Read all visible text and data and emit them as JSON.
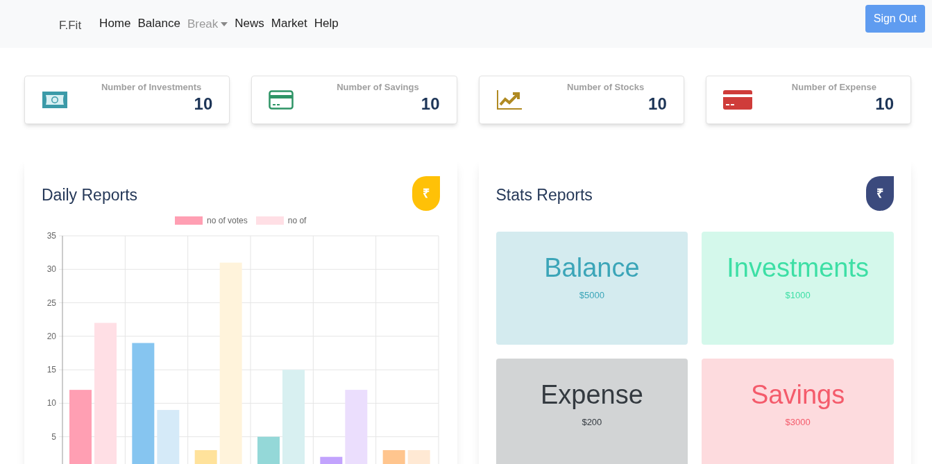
{
  "navbar": {
    "brand": "F.Fit",
    "links": [
      {
        "label": "Home",
        "disabled": false,
        "dropdown": false
      },
      {
        "label": "Balance",
        "disabled": false,
        "dropdown": false
      },
      {
        "label": "Break",
        "disabled": true,
        "dropdown": true
      },
      {
        "label": "News",
        "disabled": false,
        "dropdown": false
      },
      {
        "label": "Market",
        "disabled": false,
        "dropdown": false
      },
      {
        "label": "Help",
        "disabled": false,
        "dropdown": false
      }
    ],
    "sign_out": "Sign Out"
  },
  "summary_cards": [
    {
      "kind": "money",
      "label": "Number of Investments",
      "value": "10",
      "color": "#3b9aa8"
    },
    {
      "kind": "card",
      "label": "Number of Savings",
      "value": "10",
      "color": "#2e9466"
    },
    {
      "kind": "chart",
      "label": "Number of Stocks",
      "value": "10",
      "color": "#b08a22"
    },
    {
      "kind": "card-filled",
      "label": "Number of Expense",
      "value": "10",
      "color": "#cf3c3a"
    }
  ],
  "daily_reports": {
    "title": "Daily Reports",
    "badge": "₹",
    "chart_data": {
      "type": "bar",
      "grid": true,
      "legend": true,
      "series": [
        {
          "name": "no of votes",
          "color": "#ff9fb3",
          "colors": [
            "#ff9fb3",
            "#86c5f0",
            "#ffe29b",
            "#94d8d8",
            "#c2a3fd",
            "#ffc58e"
          ],
          "values": [
            12,
            19,
            3,
            5,
            2,
            3
          ]
        },
        {
          "name": "no of",
          "color": "#ffdfe5",
          "colors": [
            "#ffdfe5",
            "#d5eaf8",
            "#fff3db",
            "#d8f0f1",
            "#ebdefd",
            "#ffe9d4"
          ],
          "values": [
            22,
            9,
            31,
            15,
            12,
            3
          ]
        }
      ],
      "ylim": [
        0,
        35
      ],
      "yticks": [
        5,
        10,
        15,
        20,
        25,
        30,
        35
      ]
    }
  },
  "stats_reports": {
    "title": "Stats Reports",
    "badge": "₹",
    "tiles": [
      {
        "title": "Balance",
        "amount": "$5000",
        "color": "#3ba5b8"
      },
      {
        "title": "Investments",
        "amount": "$1000",
        "color": "#3ddfa5"
      },
      {
        "title": "Expense",
        "amount": "$200",
        "color": "#343a40"
      },
      {
        "title": "Savings",
        "amount": "$3000",
        "color": "#f45b6b"
      }
    ]
  }
}
